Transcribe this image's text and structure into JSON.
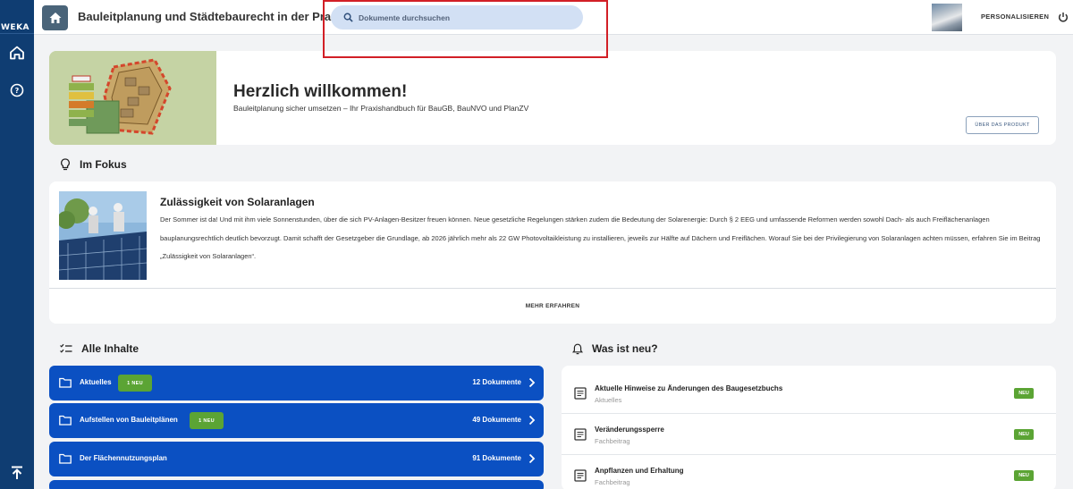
{
  "rail": {
    "logo": "WEKA"
  },
  "header": {
    "title": "Bauleitplanung und Städtebaurecht in der Praxis",
    "search_placeholder": "Dokumente durchsuchen",
    "personalize_label": "PERSONALISIEREN"
  },
  "welcome": {
    "title": "Herzlich willkommen!",
    "subtitle": "Bauleitplanung sicher umsetzen – Ihr Praxishandbuch für BauGB, BauNVO und PlanZV",
    "about_button": "ÜBER DAS PRODUKT"
  },
  "focus": {
    "heading": "Im Fokus",
    "title": "Zulässigkeit von Solaranlagen",
    "text": "Der Sommer ist da! Und mit ihm viele Sonnenstunden, über die sich PV-Anlagen-Besitzer freuen können. Neue gesetzliche Regelungen stärken zudem die Bedeutung der Solarenergie: Durch § 2 EEG und umfassende Reformen werden sowohl Dach- als auch Freiflächenanlagen bauplanungsrechtlich deutlich bevorzugt. Damit schafft der Gesetzgeber die Grundlage, ab 2026 jährlich mehr als 22 GW Photovoltaikleistung zu installieren, jeweils zur Hälfte auf Dächern und Freiflächen. Worauf Sie bei der Privilegierung von Solaranlagen achten müssen, erfahren Sie im Beitrag „Zulässigkeit von Solaranlagen“.",
    "more_label": "MEHR ERFAHREN"
  },
  "contents": {
    "heading": "Alle Inhalte",
    "categories": [
      {
        "label": "Aktuelles",
        "badge": "1 NEU",
        "count": "12 Dokumente"
      },
      {
        "label": "Aufstellen von Bauleitplänen",
        "badge": "1 NEU",
        "count": "49 Dokumente"
      },
      {
        "label": "Der Flächennutzungsplan",
        "badge": "",
        "count": "91 Dokumente"
      }
    ]
  },
  "news": {
    "heading": "Was ist neu?",
    "items": [
      {
        "title": "Aktuelle Hinweise zu Änderungen des Baugesetzbuchs",
        "category": "Aktuelles",
        "badge": "NEU"
      },
      {
        "title": "Veränderungssperre",
        "category": "Fachbeitrag",
        "badge": "NEU"
      },
      {
        "title": "Anpflanzen und Erhaltung",
        "category": "Fachbeitrag",
        "badge": "NEU"
      }
    ]
  },
  "colors": {
    "rail": "#0f3d72",
    "category_blue": "#0b50c2",
    "badge_green": "#5ba434",
    "highlight_red": "#d21f26",
    "search_bg": "#d2e0f4"
  }
}
